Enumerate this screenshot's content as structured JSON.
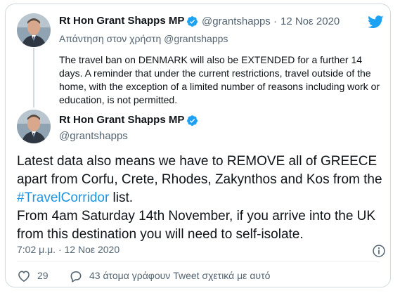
{
  "reply_tweet": {
    "display_name": "Rt Hon Grant Shapps MP",
    "handle": "@grantshapps",
    "separator": "·",
    "date": "12 Νοε 2020",
    "reply_context": "Απάντηση στον χρήστη @grantshapps",
    "text": "The travel ban on DENMARK will also be EXTENDED for a further 14 days. A reminder that under the current restrictions, travel outside of the home, with the exception of a limited number of reasons including work or education, is not permitted."
  },
  "main_tweet": {
    "display_name": "Rt Hon Grant Shapps MP",
    "handle": "@grantshapps",
    "text_line1": "Latest data also means we have to REMOVE all of GREECE",
    "text_line2": "apart from Corfu, Crete, Rhodes, Zakynthos and Kos from the",
    "hashtag": "#TravelCorridor",
    "text_line3_after": " list.",
    "text_line4": "From 4am Saturday 14th November, if you arrive into the UK",
    "text_line5": "from this destination you will need to self-isolate.",
    "timestamp": "7:02 μ.μ. · 12 Νοε 2020"
  },
  "actions": {
    "like_count": "29",
    "conversation_label": "43 άτομα γράφουν Tweet σχετικά με αυτό"
  },
  "icons": {
    "verified": "verified-badge-icon",
    "brand": "twitter-bird-icon",
    "info": "info-icon",
    "like": "heart-icon",
    "conversation": "speech-bubble-icon"
  },
  "colors": {
    "brand_blue": "#1da1f2",
    "link_blue": "#1b95e0",
    "muted_text": "#536471",
    "border": "#cfd9de"
  }
}
